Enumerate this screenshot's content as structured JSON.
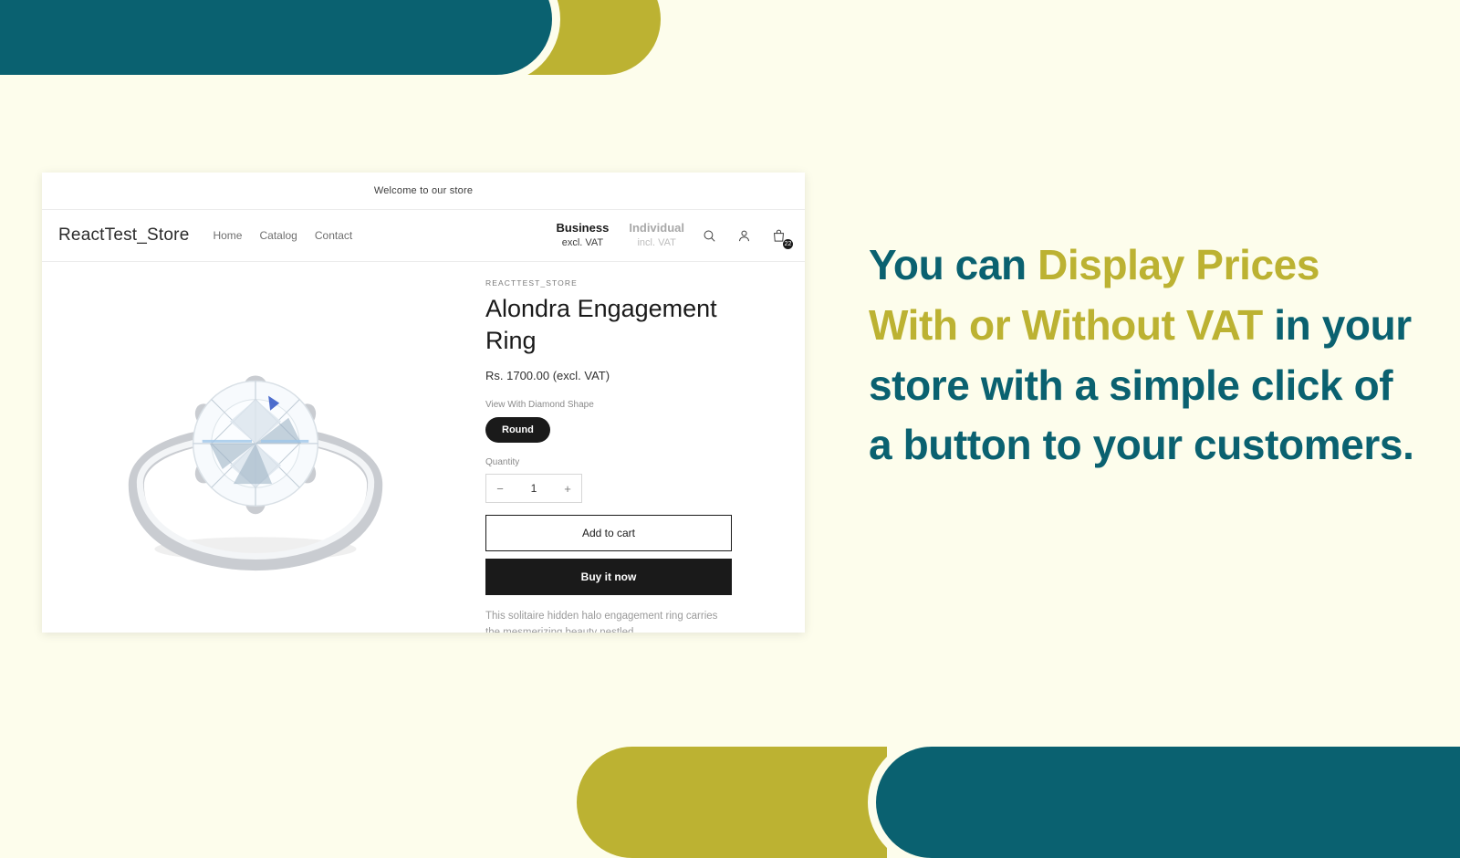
{
  "theme": {
    "teal": "#0a6170",
    "gold": "#bcb232",
    "background": "#fdfdec",
    "dark": "#1a1a1a"
  },
  "decor": {
    "top_teal": "rounded-bar-teal",
    "top_gold": "rounded-bar-gold",
    "bottom_gold": "rounded-bar-gold",
    "bottom_teal": "rounded-bar-teal"
  },
  "store": {
    "announcement": "Welcome to our store",
    "logo": "ReactTest_Store",
    "nav": [
      {
        "label": "Home"
      },
      {
        "label": "Catalog"
      },
      {
        "label": "Contact"
      }
    ],
    "vat_toggle": [
      {
        "name": "Business",
        "sub": "excl. VAT",
        "active": true
      },
      {
        "name": "Individual",
        "sub": "incl. VAT",
        "active": false
      }
    ],
    "icons": {
      "search": "search-icon",
      "account": "account-icon",
      "cart": "cart-icon"
    },
    "cart_count": "22"
  },
  "product": {
    "vendor": "REACTTEST_STORE",
    "title": "Alondra Engagement Ring",
    "price": "Rs. 1700.00 (excl. VAT)",
    "option_label": "View With Diamond Shape",
    "option_selected": "Round",
    "quantity_label": "Quantity",
    "quantity_value": "1",
    "quantity_decrease": "−",
    "quantity_increase": "+",
    "add_to_cart": "Add to cart",
    "buy_it_now": "Buy it now",
    "description": "This solitaire hidden halo engagement ring carries the mesmerizing beauty nestled",
    "image_alt": "solitaire-diamond-ring-image"
  },
  "headline": {
    "part1": "You can ",
    "part2": "Display Prices With or Without VAT",
    "part3": " in your store with a simple click of a button to your customers."
  }
}
